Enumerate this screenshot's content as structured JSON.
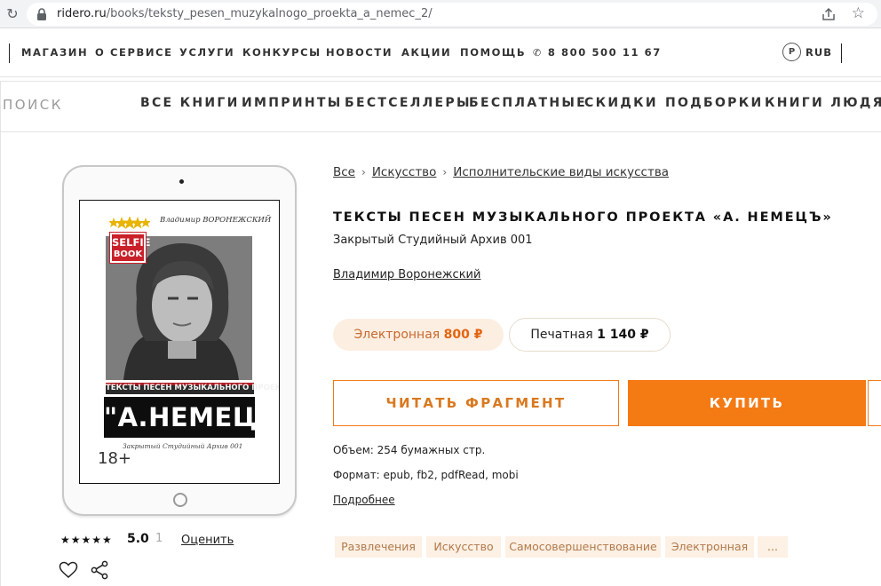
{
  "browser": {
    "url_host": "ridero.ru",
    "url_path": "/books/teksty_pesen_muzykalnogo_proekta_a_nemec_2/"
  },
  "topnav": {
    "items": [
      "МАГАЗИН",
      "О СЕРВИСЕ",
      "УСЛУГИ",
      "КОНКУРСЫ",
      "НОВОСТИ",
      "АКЦИИ",
      "ПОМОЩЬ"
    ],
    "phone": "8 800 500 11 67",
    "currency_symbol": "P",
    "currency": "RUB"
  },
  "catnav": {
    "search_placeholder": "ПОИСК",
    "items": [
      "ВСЕ КНИГИ",
      "ИМПРИНТЫ",
      "БЕСТСЕЛЛЕРЫ",
      "БЕСПЛАТНЫЕ",
      "СКИДКИ",
      "ПОДБОРКИ",
      "КНИГИ ЛЮДЯМ"
    ]
  },
  "cover": {
    "author": "Владимир ВОРОНЕЖСКИЙ",
    "badge_top": "SELFIE",
    "badge_bottom": "BOOK",
    "band_title": "ТЕКСТЫ ПЕСЕН МУЗЫКАЛЬНОГО ПРОЕКТА",
    "name": "\"А.НЕМЕЦЪ\"",
    "subtitle": "Закрытый Студийный Архив 001",
    "age": "18+"
  },
  "rating": {
    "stars": "★★★★★",
    "value": "5.0",
    "count": "1",
    "rate_label": "Оценить"
  },
  "breadcrumbs": [
    "Все",
    "Искусство",
    "Исполнительские виды искусства"
  ],
  "book": {
    "title": "ТЕКСТЫ ПЕСЕН МУЗЫКАЛЬНОГО ПРОЕКТА «А. НЕМЕЦЪ»",
    "subtitle": "Закрытый Студийный Архив 001",
    "author": "Владимир Воронежский"
  },
  "prices": {
    "electronic_label": "Электронная",
    "electronic_price": "800 ₽",
    "print_label": "Печатная",
    "print_price": "1 140 ₽"
  },
  "actions": {
    "read": "ЧИТАТЬ ФРАГМЕНТ",
    "buy": "КУПИТЬ"
  },
  "details": {
    "volume": "Объем: 254 бумажных стр.",
    "format": "Формат: epub, fb2, pdfRead, mobi",
    "more": "Подробнее"
  },
  "tags": [
    "Развлечения",
    "Искусство",
    "Самосовершенствование",
    "Электронная",
    "..."
  ]
}
